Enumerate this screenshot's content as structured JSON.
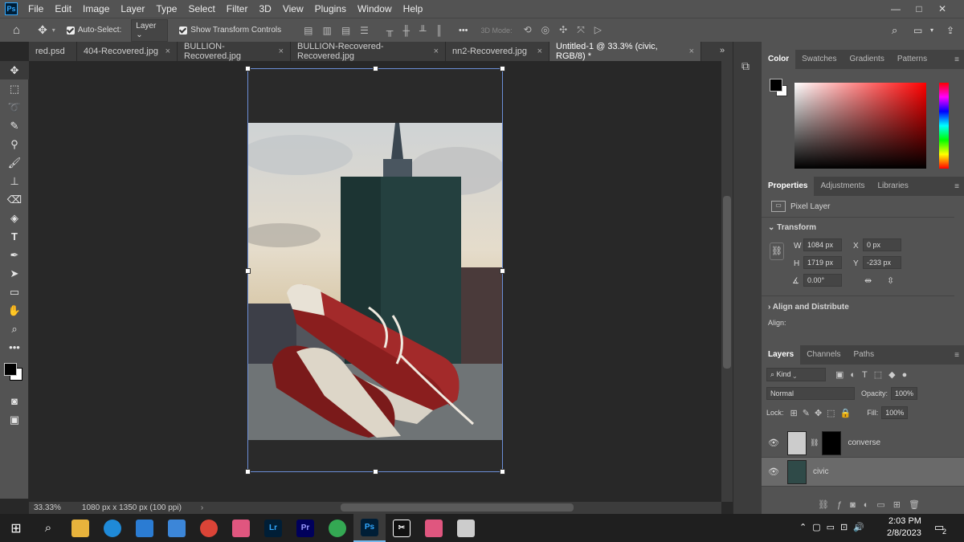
{
  "menubar": {
    "logo": "Ps",
    "items": [
      "File",
      "Edit",
      "Image",
      "Layer",
      "Type",
      "Select",
      "Filter",
      "3D",
      "View",
      "Plugins",
      "Window",
      "Help"
    ],
    "window_controls": [
      "—",
      "□",
      "✕"
    ]
  },
  "options": {
    "auto_select_label": "Auto-Select:",
    "auto_select_value": "Layer",
    "show_transform_label": "Show Transform Controls",
    "mode_3d_label": "3D Mode:",
    "more": "•••"
  },
  "tabs": [
    {
      "label": "red.psd",
      "active": false
    },
    {
      "label": "404-Recovered.jpg",
      "active": false
    },
    {
      "label": "BULLION-Recovered.jpg",
      "active": false
    },
    {
      "label": "BULLION-Recovered-Recovered.jpg",
      "active": false
    },
    {
      "label": "nn2-Recovered.jpg",
      "active": false
    },
    {
      "label": "Untitled-1 @ 33.3% (civic, RGB/8) *",
      "active": true
    }
  ],
  "tab_close": "×",
  "status": {
    "zoom": "33.33%",
    "doc_info": "1080 px x 1350 px (100 ppi)",
    "arrow": "›"
  },
  "color_panel": {
    "tabs": [
      "Color",
      "Swatches",
      "Gradients",
      "Patterns"
    ],
    "active": "Color",
    "fg": "#000000",
    "bg": "#ffffff"
  },
  "properties": {
    "tabs": [
      "Properties",
      "Adjustments",
      "Libraries"
    ],
    "active": "Properties",
    "kind": "Pixel Layer",
    "transform_title": "Transform",
    "w_label": "W",
    "w": "1084 px",
    "x_label": "X",
    "x": "0 px",
    "h_label": "H",
    "h": "1719 px",
    "y_label": "Y",
    "y": "-233 px",
    "angle": "0.00°",
    "align_title": "Align and Distribute",
    "align_label": "Align:"
  },
  "layers_panel": {
    "tabs": [
      "Layers",
      "Channels",
      "Paths"
    ],
    "active": "Layers",
    "kind": "Kind",
    "blend": "Normal",
    "opacity_label": "Opacity:",
    "opacity": "100%",
    "lock_label": "Lock:",
    "fill_label": "Fill:",
    "fill": "100%",
    "layers": [
      {
        "name": "converse",
        "selected": false
      },
      {
        "name": "civic",
        "selected": true
      }
    ]
  },
  "taskbar": {
    "time": "2:03 PM",
    "date": "2/8/2023",
    "notifications": "2",
    "apps": [
      {
        "name": "Lr",
        "color": "#001e36",
        "text_color": "#31a8ff"
      },
      {
        "name": "Pr",
        "color": "#00005b",
        "text_color": "#9999ff"
      },
      {
        "name": "Ps",
        "color": "#001e36",
        "text_color": "#31a8ff"
      }
    ]
  }
}
